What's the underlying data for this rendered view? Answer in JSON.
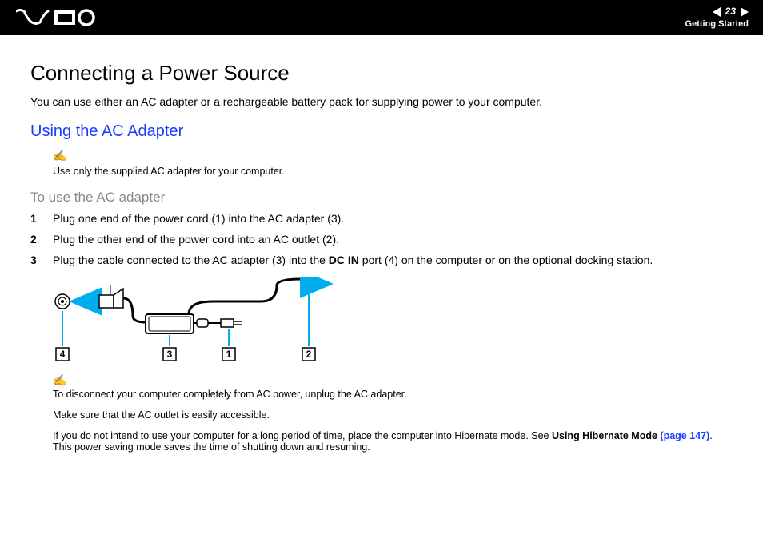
{
  "header": {
    "page_number": "23",
    "section": "Getting Started"
  },
  "title": "Connecting a Power Source",
  "intro": "You can use either an AC adapter or a rechargeable battery pack for supplying power to your computer.",
  "subheading": "Using the AC Adapter",
  "note1": "Use only the supplied AC adapter for your computer.",
  "procedure_heading": "To use the AC adapter",
  "steps": [
    {
      "n": "1",
      "text": "Plug one end of the power cord (1) into the AC adapter (3)."
    },
    {
      "n": "2",
      "text": "Plug the other end of the power cord into an AC outlet (2)."
    },
    {
      "n": "3",
      "text_before": "Plug the cable connected to the AC adapter (3) into the ",
      "bold": "DC IN",
      "text_after": " port (4) on the computer or on the optional docking station."
    }
  ],
  "diagram_labels": {
    "l4": "4",
    "l3": "3",
    "l1": "1",
    "l2": "2"
  },
  "note2": "To disconnect your computer completely from AC power, unplug the AC adapter.",
  "note3": "Make sure that the AC outlet is easily accessible.",
  "note4_before": "If you do not intend to use your computer for a long period of time, place the computer into Hibernate mode. See ",
  "note4_bold": "Using Hibernate Mode ",
  "note4_link": "(page 147)",
  "note4_after": ". This power saving mode saves the time of shutting down and resuming."
}
